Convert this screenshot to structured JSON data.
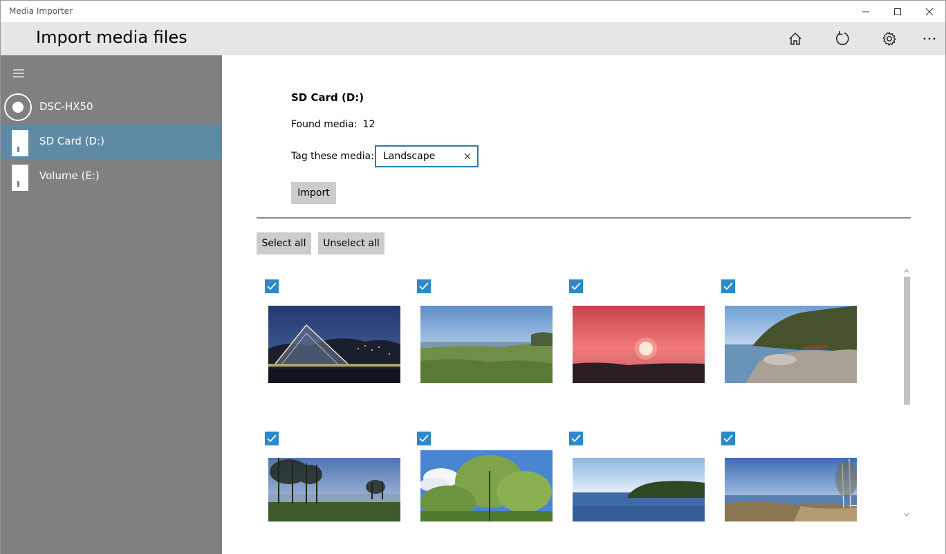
{
  "window": {
    "title": "Media Importer"
  },
  "header": {
    "title": "Import media files"
  },
  "sidebar": {
    "items": [
      {
        "label": "DSC-HX50",
        "icon": "camera-disc-icon",
        "selected": false
      },
      {
        "label": "SD Card (D:)",
        "icon": "drive-icon",
        "selected": true
      },
      {
        "label": "Volume (E:)",
        "icon": "drive-icon",
        "selected": false
      }
    ]
  },
  "main": {
    "drive_title": "SD Card (D:)",
    "found_label": "Found media:",
    "found_count": "12",
    "tag_label": "Tag these media:",
    "tag_value": "Landscape",
    "import_label": "Import",
    "select_all_label": "Select all",
    "unselect_all_label": "Unselect all"
  },
  "media": [
    {
      "subject": "illuminated-bridge-night",
      "checked": true
    },
    {
      "subject": "grassy-shore-sea",
      "checked": true
    },
    {
      "subject": "red-sunset",
      "checked": true
    },
    {
      "subject": "rocky-lake-shore",
      "checked": true
    },
    {
      "subject": "trees-by-lake",
      "checked": true
    },
    {
      "subject": "spring-birch-trees",
      "checked": true
    },
    {
      "subject": "lake-forest-island",
      "checked": true
    },
    {
      "subject": "shore-reeds-path",
      "checked": true
    }
  ],
  "colors": {
    "accent": "#2a89c9",
    "selected_nav": "#5f8aa5",
    "sidebar": "#808080",
    "header": "#e6e6e6",
    "button": "#cccccc"
  }
}
